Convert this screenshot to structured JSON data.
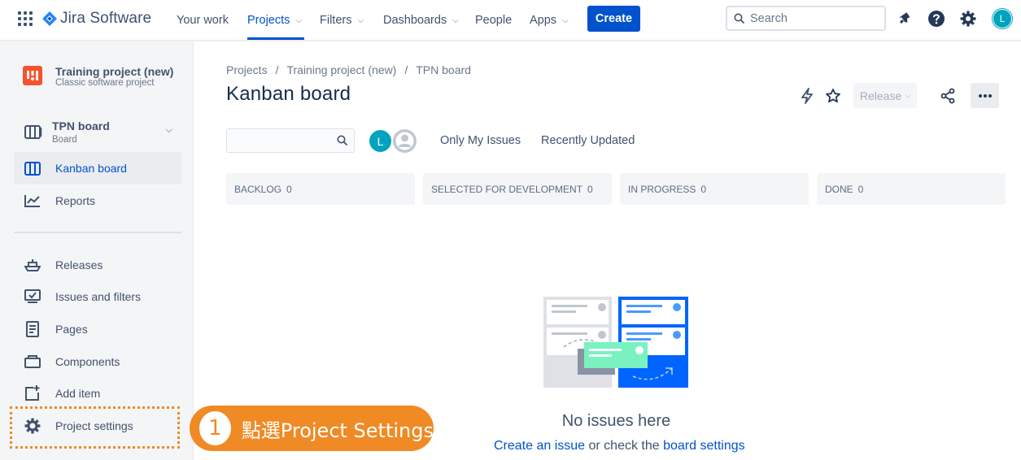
{
  "topnav": {
    "product": "Jira Software",
    "items": [
      {
        "label": "Your work",
        "dropdown": false,
        "active": false
      },
      {
        "label": "Projects",
        "dropdown": true,
        "active": true
      },
      {
        "label": "Filters",
        "dropdown": true,
        "active": false
      },
      {
        "label": "Dashboards",
        "dropdown": true,
        "active": false
      },
      {
        "label": "People",
        "dropdown": false,
        "active": false
      },
      {
        "label": "Apps",
        "dropdown": true,
        "active": false
      }
    ],
    "create_label": "Create",
    "search_placeholder": "Search",
    "icons": [
      "notifications-icon",
      "help-icon",
      "settings-icon"
    ],
    "user_initial": "L"
  },
  "sidebar": {
    "project_name": "Training project (new)",
    "project_type": "Classic software project",
    "board_name": "TPN board",
    "board_type": "Board",
    "items": [
      {
        "label": "Kanban board",
        "icon": "board-icon",
        "active": true
      },
      {
        "label": "Reports",
        "icon": "chart-icon",
        "active": false
      },
      {
        "label": "Releases",
        "icon": "ship-icon",
        "active": false
      },
      {
        "label": "Issues and filters",
        "icon": "issues-icon",
        "active": false
      },
      {
        "label": "Pages",
        "icon": "page-icon",
        "active": false
      },
      {
        "label": "Components",
        "icon": "component-icon",
        "active": false
      },
      {
        "label": "Add item",
        "icon": "add-item-icon",
        "active": false
      },
      {
        "label": "Project settings",
        "icon": "gear-icon",
        "active": false
      }
    ]
  },
  "main": {
    "breadcrumb": [
      "Projects",
      "Training project (new)",
      "TPN board"
    ],
    "title": "Kanban board",
    "release_label": "Release",
    "avatar_initial": "L",
    "filters": [
      "Only My Issues",
      "Recently Updated"
    ],
    "columns": [
      {
        "name": "BACKLOG",
        "count": "0"
      },
      {
        "name": "SELECTED FOR DEVELOPMENT",
        "count": "0"
      },
      {
        "name": "IN PROGRESS",
        "count": "0"
      },
      {
        "name": "DONE",
        "count": "0"
      }
    ],
    "empty_title": "No issues here",
    "empty_link_1": "Create an issue",
    "empty_middle": " or check the ",
    "empty_link_2": "board settings"
  },
  "callout": {
    "number": "1",
    "text": "點選Project Settings"
  },
  "colors": {
    "brand": "#0052cc",
    "callout": "#f08a24",
    "avatar": "#00a3bf",
    "project_icon": "#f4532b"
  }
}
